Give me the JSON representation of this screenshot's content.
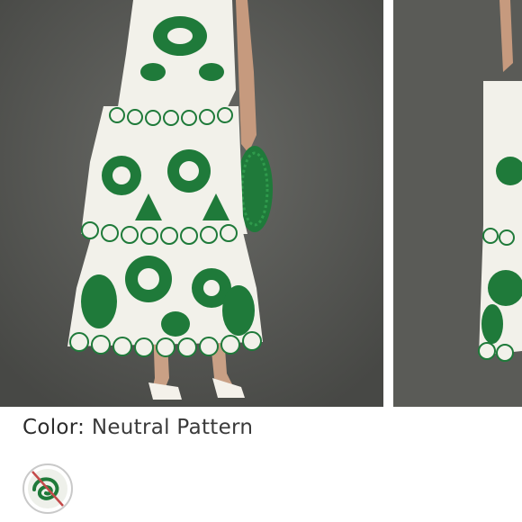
{
  "product": {
    "color_label": "Color:",
    "color_value": "Neutral Pattern",
    "selected_swatch": "neutral-pattern-swatch",
    "swatch_state": "unavailable"
  },
  "icons": {
    "swatch_overlay": "strike-through-slash-icon"
  },
  "colors": {
    "background": "#ffffff",
    "photo_backdrop": "#555653",
    "embroidery_green": "#1f7a3a",
    "fabric_white": "#f2f1ea",
    "swatch_ring": "#c9c9c9",
    "unavailable_slash": "#c44a4a"
  }
}
